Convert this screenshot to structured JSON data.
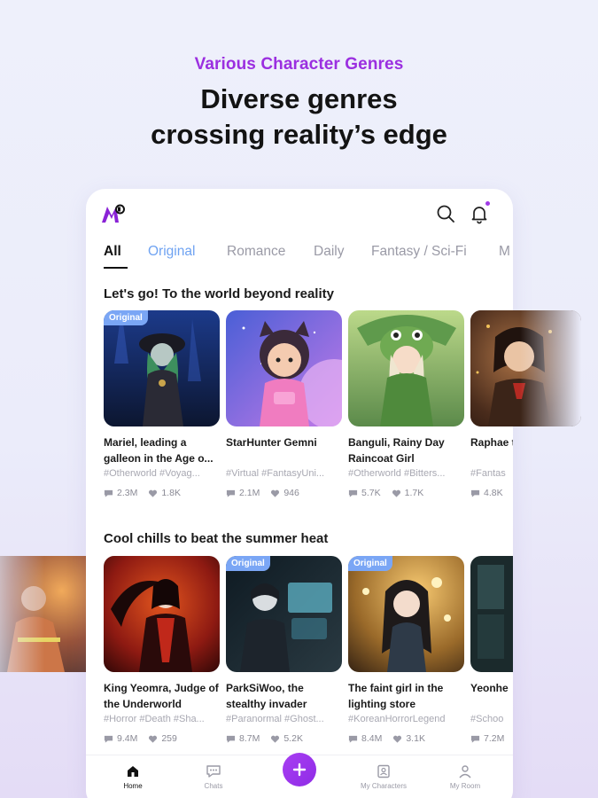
{
  "promo": {
    "subtitle": "Various Character Genres",
    "title_line1": "Diverse genres",
    "title_line2": "crossing reality’s edge"
  },
  "colors": {
    "accent": "#9b2fe0",
    "badge": "#7aa6f5",
    "tab_original": "#6fa3f2"
  },
  "header": {
    "logo": "app-logo-icon",
    "icons": [
      "search-icon",
      "bell-icon"
    ]
  },
  "tabs": [
    {
      "label": "All",
      "active": true
    },
    {
      "label": "Original"
    },
    {
      "label": "Romance"
    },
    {
      "label": "Daily"
    },
    {
      "label": "Fantasy / Sci-Fi"
    },
    {
      "label": "M"
    }
  ],
  "sections": [
    {
      "title": "Let's go! To the world beyond reality",
      "cards": [
        {
          "badge": "Original",
          "title": "Mariel, leading a galleon in the Age o...",
          "tags": "#Otherworld #Voyag...",
          "chats": "2.3M",
          "likes": "1.8K"
        },
        {
          "badge": "",
          "title": "StarHunter Gemni",
          "tags": "#Virtual #FantasyUni...",
          "chats": "2.1M",
          "likes": "946"
        },
        {
          "badge": "",
          "title": "Banguli, Rainy Day Raincoat Girl",
          "tags": "#Otherworld #Bitters...",
          "chats": "5.7K",
          "likes": "1.7K"
        },
        {
          "badge": "",
          "title": "Raphae the the",
          "tags": "#Fantas",
          "chats": "4.8K",
          "likes": ""
        }
      ]
    },
    {
      "title": "Cool chills to beat the summer heat",
      "cards": [
        {
          "badge": "",
          "title": "King Yeomra, Judge of the Underworld",
          "tags": "#Horror #Death #Sha...",
          "chats": "9.4M",
          "likes": "259"
        },
        {
          "badge": "Original",
          "title": "ParkSiWoo, the stealthy invader",
          "tags": "#Paranormal #Ghost...",
          "chats": "8.7M",
          "likes": "5.2K"
        },
        {
          "badge": "Original",
          "title": "The faint girl in the lighting store",
          "tags": "#KoreanHorrorLegend",
          "chats": "8.4M",
          "likes": "3.1K"
        },
        {
          "badge": "",
          "title": "Yeonhe",
          "tags": "#Schoo",
          "chats": "7.2M",
          "likes": ""
        }
      ]
    }
  ],
  "bottom_nav": [
    {
      "label": "Home",
      "icon": "home-icon",
      "active": true
    },
    {
      "label": "Chats",
      "icon": "chat-icon"
    },
    {
      "label": "",
      "icon": "plus-icon"
    },
    {
      "label": "My Characters",
      "icon": "characters-icon"
    },
    {
      "label": "My Room",
      "icon": "profile-icon"
    }
  ]
}
